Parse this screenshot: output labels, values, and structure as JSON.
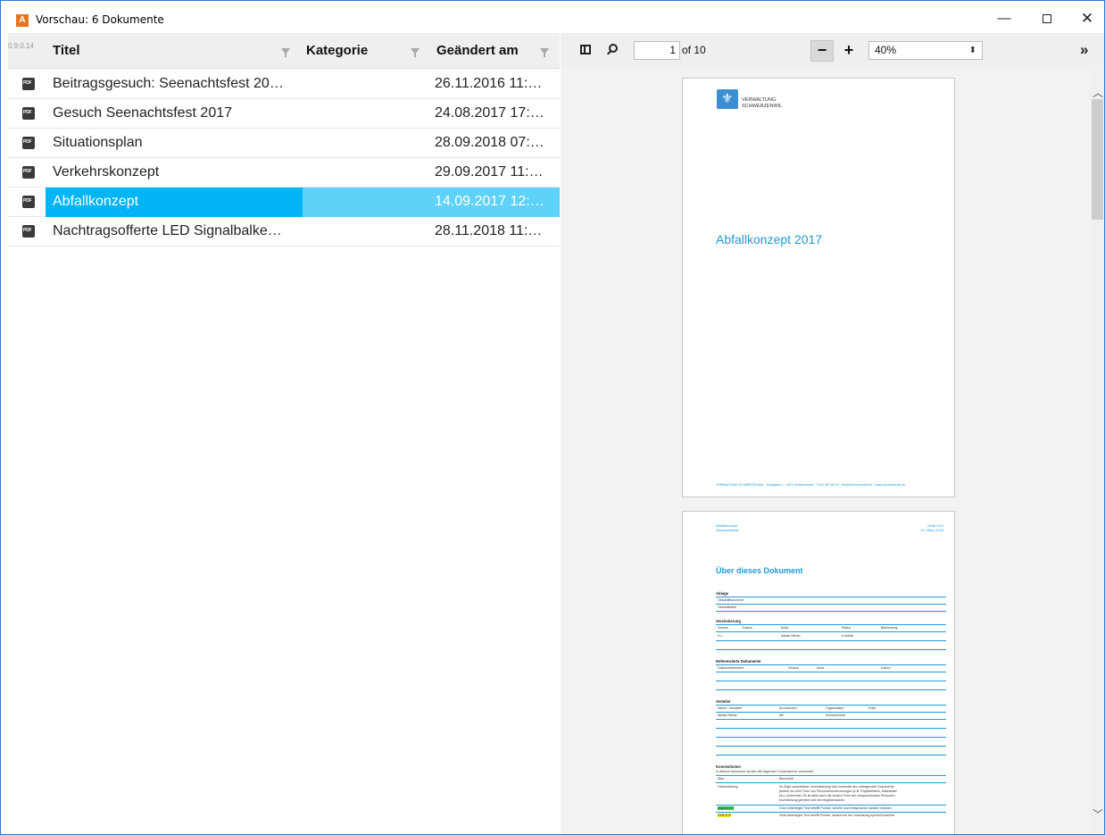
{
  "window": {
    "app_icon_letter": "A",
    "title": "Vorschau: 6 Dokumente",
    "minimize": "—",
    "close": "✕"
  },
  "grid": {
    "version": "0.9.0.14",
    "columns": [
      "Titel",
      "Kategorie",
      "Geändert am"
    ],
    "rows": [
      {
        "title": "Beitragsgesuch: Seenachtsfest 20…",
        "category": "",
        "date": "26.11.2016 11:…",
        "selected": false
      },
      {
        "title": "Gesuch Seenachtsfest 2017",
        "category": "",
        "date": "24.08.2017 17:…",
        "selected": false
      },
      {
        "title": "Situationsplan",
        "category": "",
        "date": "28.09.2018 07:…",
        "selected": false
      },
      {
        "title": "Verkehrskonzept",
        "category": "",
        "date": "29.09.2017 11:…",
        "selected": false
      },
      {
        "title": "Abfallkonzept",
        "category": "",
        "date": "14.09.2017 12:…",
        "selected": true
      },
      {
        "title": "Nachtragsofferte LED Signalbalke…",
        "category": "",
        "date": "28.11.2018 11:…",
        "selected": false
      }
    ]
  },
  "viewer": {
    "page_number": "1",
    "page_of": "of 10",
    "zoom_out": "−",
    "zoom_in": "+",
    "zoom": "40%",
    "zoom_arrow": "⬍",
    "more": "»"
  },
  "page1": {
    "org_line1": "VERWALTUNG",
    "org_line2": "SCHWERZENWIL",
    "doc_title": "Abfallkonzept 2017",
    "footer": "VERWALTUNG SCHWERZENWIL · Dorfgasse 1 · 4870 Schwerzenwil · T 041 587 85 43 · info@schwerzenwil.ch · www.schwerzenwil.ch"
  },
  "page2": {
    "head_left1": "Abfallkonzept",
    "head_left2": "Seenachtsfest",
    "head_right1": "Seite 2/10",
    "head_right2": "10. März 2018",
    "title": "Über dieses Dokument",
    "ablage": "Ablage",
    "ablage_row1": "Geschäftsnummer",
    "ablage_row2": "Geschäftsfall",
    "versionierung": "Versionierung",
    "ver_cols": [
      "Version",
      "Datum",
      "Autor",
      "Status",
      "Bemerkung"
    ],
    "ver_row": [
      "0.1",
      "",
      "Adrian Bieher",
      "In Arbeit",
      ""
    ],
    "referenziert": "Referenzierte Dokumente",
    "ref_cols": [
      "Dokumentenname",
      "Version",
      "Autor",
      "Datum"
    ],
    "verteiler": "Verteiler",
    "vert_cols": [
      "Name / Vorname",
      "Kurzzeichen",
      "Organisation",
      "Rolle"
    ],
    "vert_row": [
      "Adrian Bieher",
      "AB",
      "Schwerzenwil",
      ""
    ],
    "konventionen": "Konventionen",
    "konv_text": "In diesem Dokument wurden die folgenden Konventionen verwendet:",
    "konv_cols": [
      "Was",
      "Beschrieb"
    ],
    "gleich": "Gleichstellung",
    "gleich_text1": "Im Zuge sprachlicher Vereinfachung wird innerhalb des vorliegenden Dokuments",
    "gleich_text2": "jeweils nur eine Form von Personenbezeichnungen (z.B. Projektleiterin, Mitarbeiter",
    "gleich_text3": "etc.) verwendet. Es ist stets auch die andere Form der entsprechenden Personen-",
    "gleich_text4": "bezeichnung gemeint und mit eingeschlossen.",
    "gruen": "Grün & ???",
    "gruen_text": "Grün hinterlegter Text betrifft Punkte, welche noch besprochen werden müssen",
    "gelb": "Gelb & !!!",
    "gelb_text": "Gelb hinterlegter Text betrifft Punkte, welche bei der Umsetzung speziell beachtet"
  }
}
